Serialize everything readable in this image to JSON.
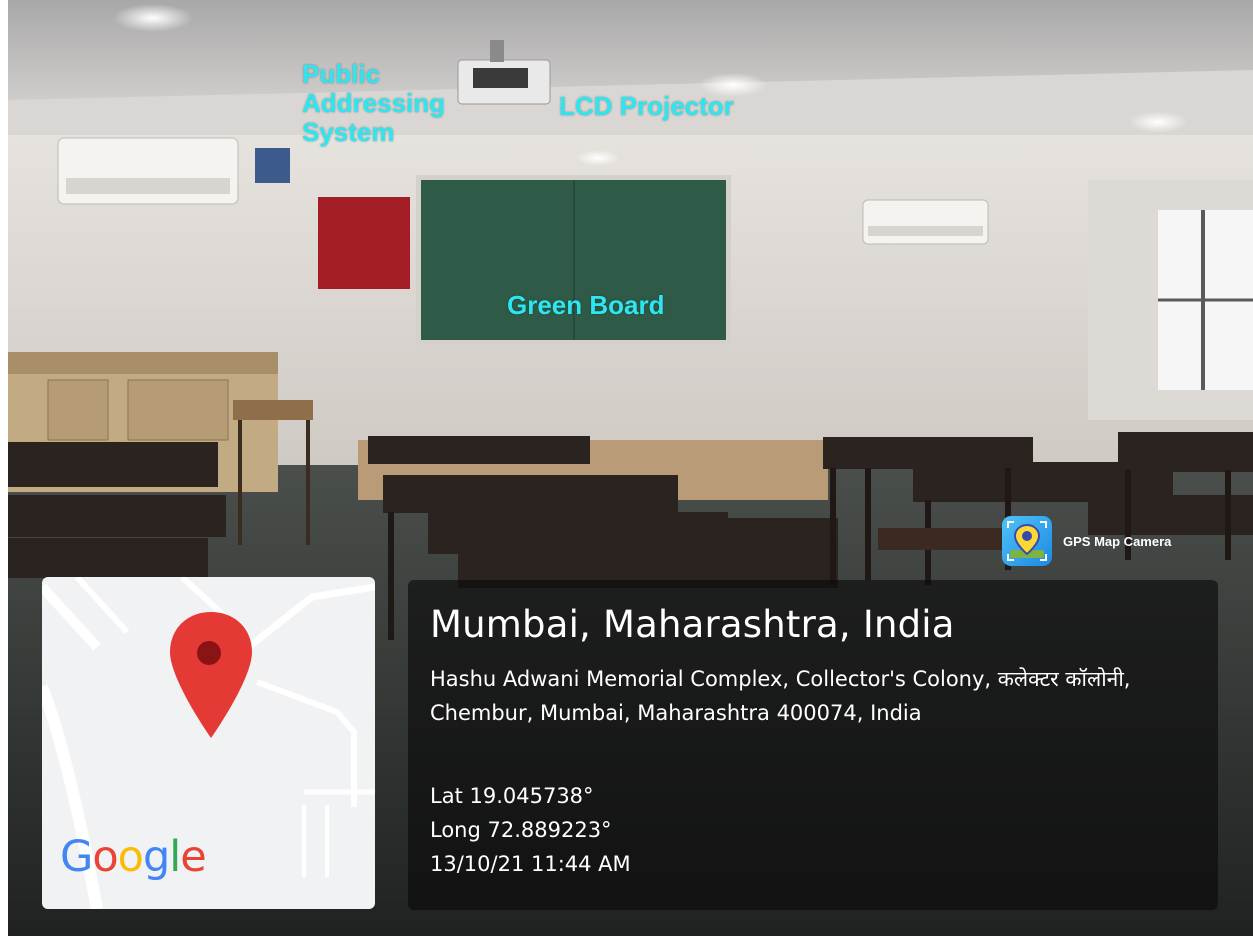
{
  "annotations": {
    "public_addressing": "Public\nAddressing\nSystem",
    "lcd_projector": "LCD Projector",
    "green_board": "Green Board"
  },
  "gps": {
    "app_name": "GPS Map Camera",
    "place_title": "Mumbai, Maharashtra, India",
    "address": "Hashu Adwani Memorial Complex, Collector's Colony, कलेक्टर कॉलोनी, Chembur, Mumbai, Maharashtra 400074, India",
    "lat": "Lat 19.045738°",
    "long": "Long 72.889223°",
    "timestamp": "13/10/21 11:44 AM"
  },
  "map": {
    "logo_letters": [
      "G",
      "o",
      "o",
      "g",
      "l",
      "e"
    ],
    "logo_colors": [
      "#4285F4",
      "#EA4335",
      "#FBBC05",
      "#4285F4",
      "#34A853",
      "#EA4335"
    ],
    "pin_color": "#E53935"
  },
  "colors": {
    "annotation": "#2ee6f0",
    "overlay": "#080808"
  }
}
